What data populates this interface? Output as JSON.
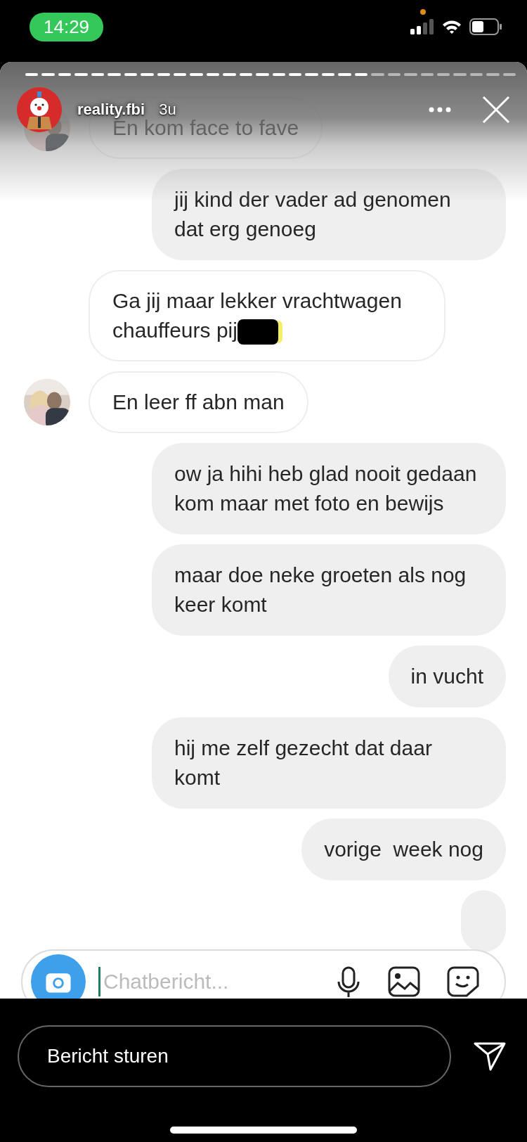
{
  "status_bar": {
    "time": "14:29"
  },
  "story": {
    "progress": [
      {
        "level": 1
      },
      {
        "level": 1
      },
      {
        "level": 1
      },
      {
        "level": 1
      },
      {
        "level": 1
      },
      {
        "level": 1
      },
      {
        "level": 1
      },
      {
        "level": 1
      },
      {
        "level": 1
      },
      {
        "level": 1
      },
      {
        "level": 1
      },
      {
        "level": 1
      },
      {
        "level": 1
      },
      {
        "level": 1
      },
      {
        "level": 1
      },
      {
        "level": 1
      },
      {
        "level": 1
      },
      {
        "level": 1
      },
      {
        "level": 1
      },
      {
        "level": 1
      },
      {
        "level": 1
      },
      {
        "level": 0
      },
      {
        "level": 0
      },
      {
        "level": 0
      },
      {
        "level": 0
      },
      {
        "level": 0
      },
      {
        "level": 0
      },
      {
        "level": 0
      },
      {
        "level": 0
      },
      {
        "level": 0
      }
    ],
    "username": "reality.fbi",
    "age": "3u"
  },
  "messages": [
    {
      "kind": "received",
      "text": "En kom face to fave",
      "avatar": true
    },
    {
      "kind": "sent",
      "text": "jij kind der vader ad genomen dat erg genoeg"
    },
    {
      "kind": "received",
      "text": "Ga jij maar lekker vrachtwagen chauffeurs pij",
      "avatar": false,
      "redacted": true
    },
    {
      "kind": "received",
      "text": "En leer ff abn man",
      "avatar": true
    },
    {
      "kind": "sent",
      "text": "ow ja hihi heb glad nooit gedaan kom maar met foto en bewijs"
    },
    {
      "kind": "sent",
      "text": "maar doe neke groeten als nog keer komt"
    },
    {
      "kind": "sent",
      "text": "in vucht"
    },
    {
      "kind": "sent",
      "text": "hij me zelf gezecht dat daar komt"
    },
    {
      "kind": "sent",
      "text": "vorige  week nog"
    },
    {
      "kind": "sent"
    }
  ],
  "composer": {
    "placeholder": "Chatbericht..."
  },
  "reply": {
    "placeholder": "Bericht sturen"
  }
}
